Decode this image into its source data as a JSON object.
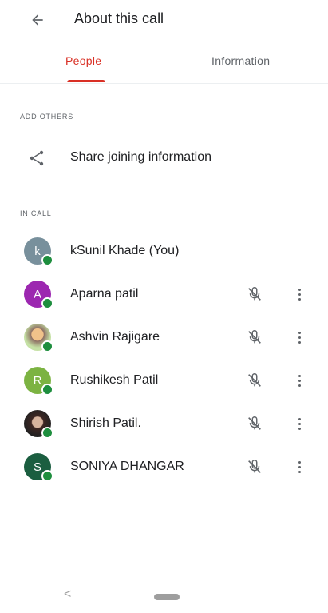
{
  "header": {
    "title": "About this call",
    "back_icon": "arrow-left-icon"
  },
  "tabs": [
    {
      "label": "People",
      "active": true,
      "color": "#d93025"
    },
    {
      "label": "Information",
      "active": false
    }
  ],
  "sections": {
    "add_others": "ADD OTHERS",
    "in_call": "IN CALL"
  },
  "share": {
    "label": "Share joining information",
    "icon": "share-icon"
  },
  "participants": [
    {
      "name": "kSunil Khade (You)",
      "avatar_letter": "k",
      "avatar_color": "#78909c",
      "photo": false,
      "muted_icon": false
    },
    {
      "name": "Aparna patil",
      "avatar_letter": "A",
      "avatar_color": "#9c27b0",
      "photo": false,
      "muted_icon": true
    },
    {
      "name": "Ashvin Rajigare",
      "avatar_letter": "",
      "avatar_color": "#8d6e63",
      "photo": true,
      "muted_icon": true
    },
    {
      "name": "Rushikesh Patil",
      "avatar_letter": "R",
      "avatar_color": "#7cb342",
      "photo": false,
      "muted_icon": true
    },
    {
      "name": "Shirish Patil.",
      "avatar_letter": "",
      "avatar_color": "#4e342e",
      "photo": true,
      "muted_icon": true
    },
    {
      "name": "SONIYA DHANGAR",
      "avatar_letter": "S",
      "avatar_color": "#1b5e40",
      "photo": false,
      "muted_icon": true
    }
  ],
  "colors": {
    "presence": "#1e8e3e",
    "accent": "#d93025"
  },
  "navbar": {
    "back_glyph": "<"
  }
}
